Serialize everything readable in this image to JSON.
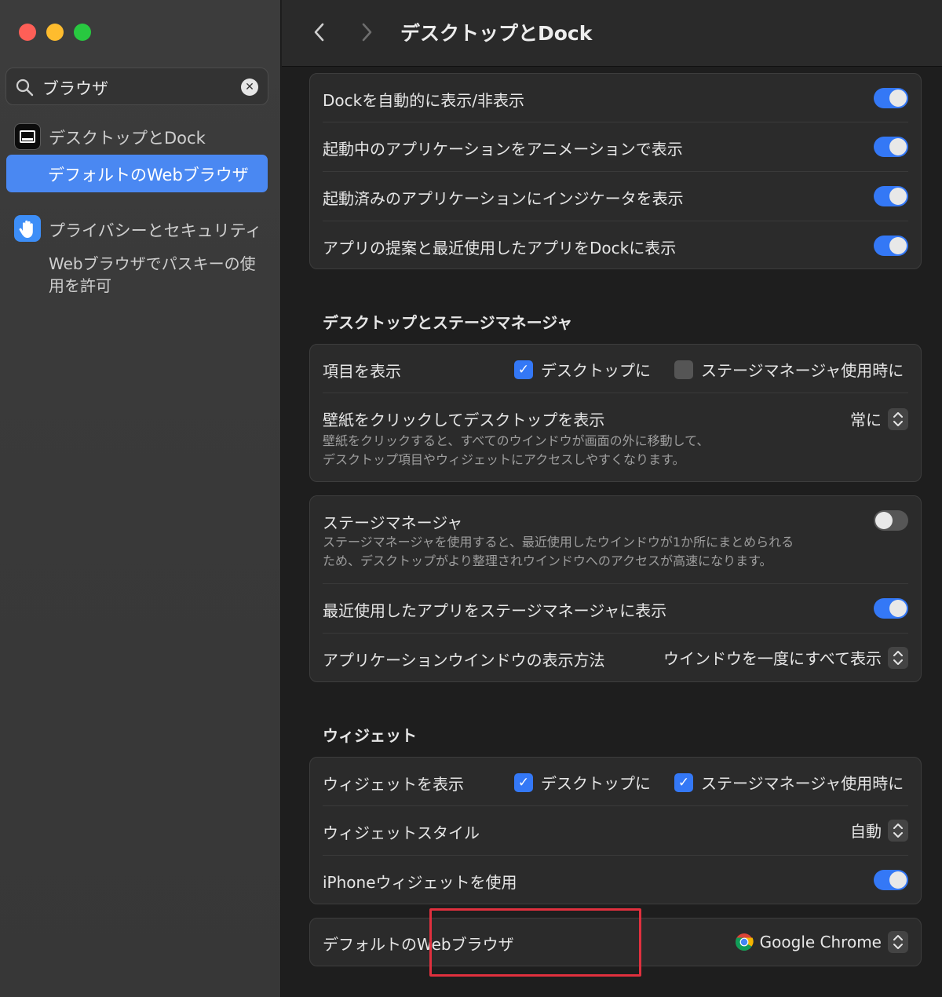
{
  "sidebar": {
    "search_query": "ブラウザ",
    "items": [
      {
        "label": "デスクトップとDock",
        "icon": "dock-icon"
      },
      {
        "label": "デフォルトのWebブラウザ",
        "selected": true
      },
      {
        "label": "プライバシーとセキュリティ",
        "icon": "hand-icon"
      },
      {
        "label": "Webブラウザでパスキーの使用を許可"
      }
    ]
  },
  "toolbar": {
    "title": "デスクトップとDock"
  },
  "dock_panel": {
    "rows": [
      {
        "label": "Dockを自動的に表示/非表示",
        "on": true
      },
      {
        "label": "起動中のアプリケーションをアニメーションで表示",
        "on": true
      },
      {
        "label": "起動済みのアプリケーションにインジケータを表示",
        "on": true
      },
      {
        "label": "アプリの提案と最近使用したアプリをDockに表示",
        "on": true
      }
    ]
  },
  "desktop_section": {
    "heading": "デスクトップとステージマネージャ",
    "show_items": {
      "label": "項目を表示",
      "desktop": {
        "label": "デスクトップに",
        "checked": true
      },
      "stage": {
        "label": "ステージマネージャ使用時に",
        "checked": false
      }
    },
    "click_wallpaper": {
      "label": "壁紙をクリックしてデスクトップを表示",
      "desc1": "壁紙をクリックすると、すべてのウインドウが画面の外に移動して、",
      "desc2": "デスクトップ項目やウィジェットにアクセスしやすくなります。",
      "value": "常に"
    }
  },
  "stage_panel": {
    "stage_manager": {
      "label": "ステージマネージャ",
      "desc1": "ステージマネージャを使用すると、最近使用したウインドウが1か所にまとめられる",
      "desc2": "ため、デスクトップがより整理されウインドウへのアクセスが高速になります。",
      "on": false
    },
    "recent_apps": {
      "label": "最近使用したアプリをステージマネージャに表示",
      "on": true
    },
    "app_windows": {
      "label": "アプリケーションウインドウの表示方法",
      "value": "ウインドウを一度にすべて表示"
    }
  },
  "widgets_section": {
    "heading": "ウィジェット",
    "show_widgets": {
      "label": "ウィジェットを表示",
      "desktop": {
        "label": "デスクトップに",
        "checked": true
      },
      "stage": {
        "label": "ステージマネージャ使用時に",
        "checked": true
      }
    },
    "style": {
      "label": "ウィジェットスタイル",
      "value": "自動"
    },
    "iphone": {
      "label": "iPhoneウィジェットを使用",
      "on": true
    }
  },
  "browser_panel": {
    "label": "デフォルトのWebブラウザ",
    "value": "Google Chrome"
  },
  "colors": {
    "accent": "#3478f6",
    "sidebar_selection": "#4a88f2",
    "highlight_box": "#e0303e"
  }
}
